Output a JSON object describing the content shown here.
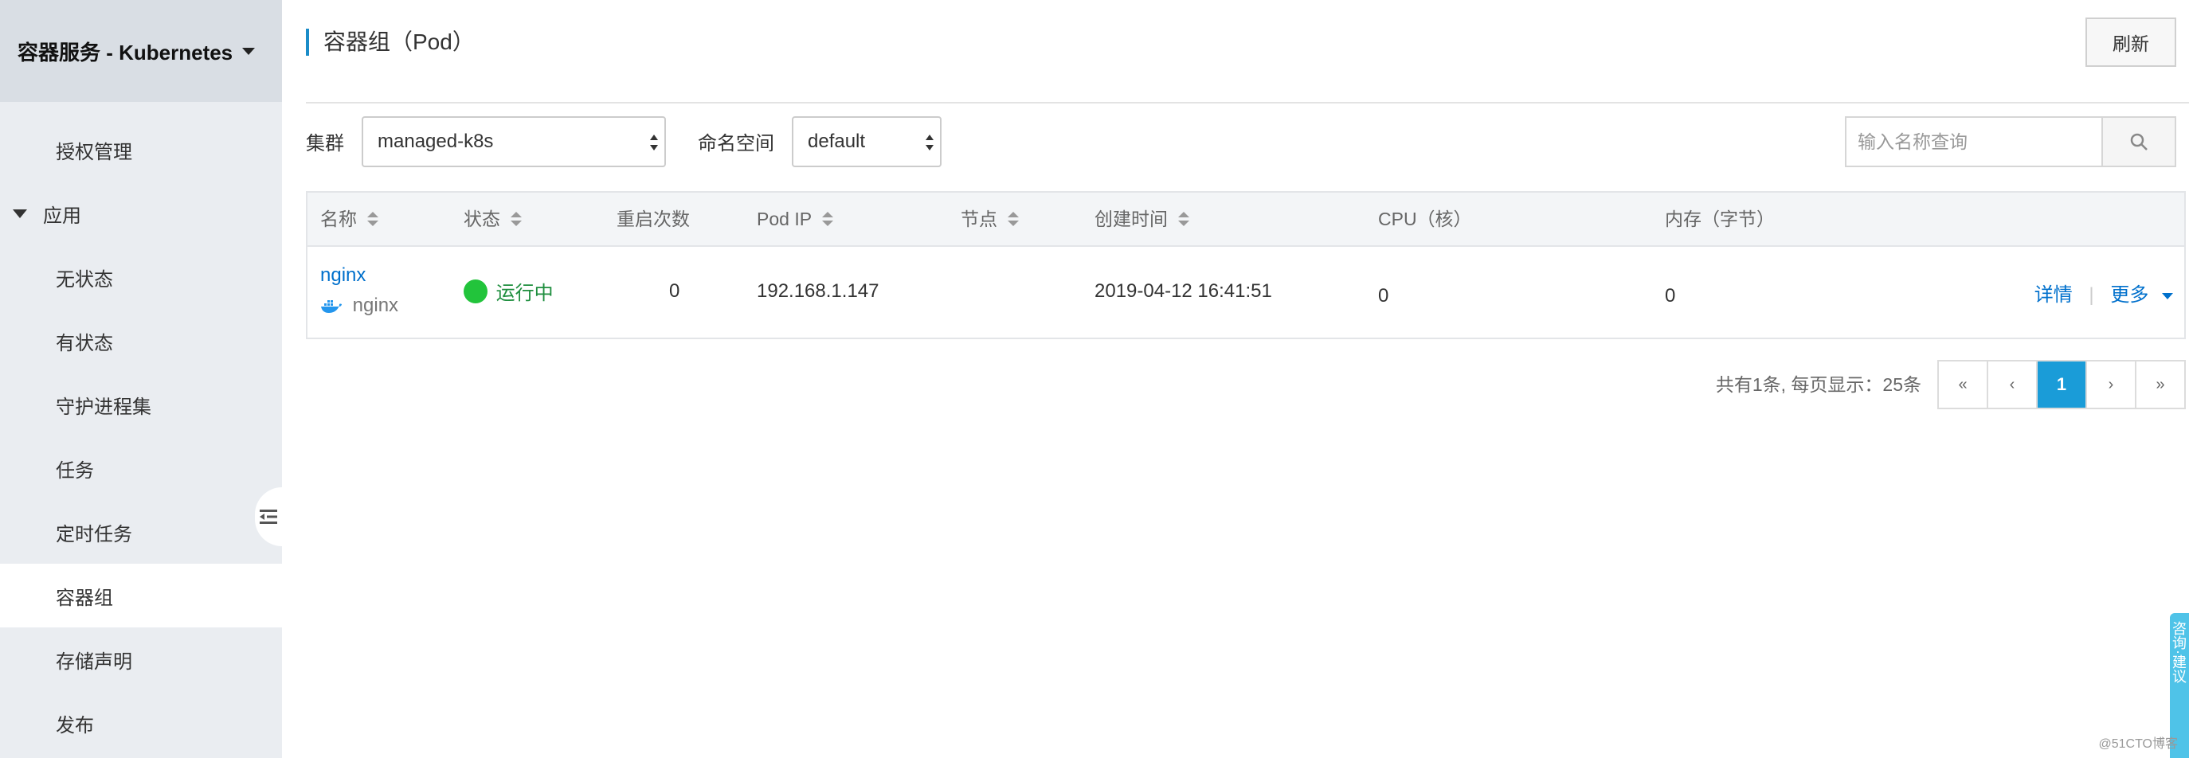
{
  "sidebar": {
    "title": "容器服务 - Kubernetes",
    "items": [
      {
        "label": "授权管理",
        "type": "item"
      },
      {
        "label": "应用",
        "type": "group"
      },
      {
        "label": "无状态",
        "type": "item"
      },
      {
        "label": "有状态",
        "type": "item"
      },
      {
        "label": "守护进程集",
        "type": "item"
      },
      {
        "label": "任务",
        "type": "item"
      },
      {
        "label": "定时任务",
        "type": "item"
      },
      {
        "label": "容器组",
        "type": "item",
        "active": true
      },
      {
        "label": "存储声明",
        "type": "item"
      },
      {
        "label": "发布",
        "type": "item"
      }
    ]
  },
  "page": {
    "title": "容器组（Pod）",
    "refresh_label": "刷新"
  },
  "filters": {
    "cluster_label": "集群",
    "cluster_value": "managed-k8s",
    "namespace_label": "命名空间",
    "namespace_value": "default",
    "search_placeholder": "输入名称查询"
  },
  "table": {
    "columns": [
      "名称",
      "状态",
      "重启次数",
      "Pod IP",
      "节点",
      "创建时间",
      "CPU（核）",
      "内存（字节）"
    ],
    "rows": [
      {
        "name": "nginx",
        "image": "nginx",
        "status": "运行中",
        "restarts": "0",
        "pod_ip": "192.168.1.147",
        "node": "",
        "created": "2019-04-12 16:41:51",
        "cpu": "0",
        "memory": "0",
        "action_detail": "详情",
        "action_more": "更多"
      }
    ]
  },
  "pagination": {
    "info": "共有1条, 每页显示：25条",
    "first": "«",
    "prev": "‹",
    "current": "1",
    "next": "›",
    "last": "»"
  },
  "feedback_tab": "咨询·建议",
  "watermark": "@51CTO博客",
  "colors": {
    "accent": "#1a9cd8",
    "link": "#0070cc",
    "running": "#22c43b",
    "sidebar_bg": "#eaedf1"
  }
}
